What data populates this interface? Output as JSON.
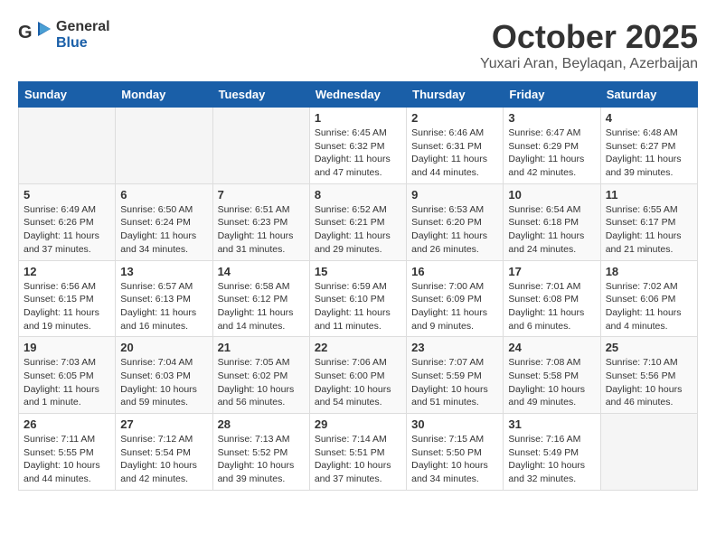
{
  "header": {
    "logo_general": "General",
    "logo_blue": "Blue",
    "month": "October 2025",
    "location": "Yuxari Aran, Beylaqan, Azerbaijan"
  },
  "weekdays": [
    "Sunday",
    "Monday",
    "Tuesday",
    "Wednesday",
    "Thursday",
    "Friday",
    "Saturday"
  ],
  "weeks": [
    [
      {
        "day": "",
        "info": ""
      },
      {
        "day": "",
        "info": ""
      },
      {
        "day": "",
        "info": ""
      },
      {
        "day": "1",
        "info": "Sunrise: 6:45 AM\nSunset: 6:32 PM\nDaylight: 11 hours and 47 minutes."
      },
      {
        "day": "2",
        "info": "Sunrise: 6:46 AM\nSunset: 6:31 PM\nDaylight: 11 hours and 44 minutes."
      },
      {
        "day": "3",
        "info": "Sunrise: 6:47 AM\nSunset: 6:29 PM\nDaylight: 11 hours and 42 minutes."
      },
      {
        "day": "4",
        "info": "Sunrise: 6:48 AM\nSunset: 6:27 PM\nDaylight: 11 hours and 39 minutes."
      }
    ],
    [
      {
        "day": "5",
        "info": "Sunrise: 6:49 AM\nSunset: 6:26 PM\nDaylight: 11 hours and 37 minutes."
      },
      {
        "day": "6",
        "info": "Sunrise: 6:50 AM\nSunset: 6:24 PM\nDaylight: 11 hours and 34 minutes."
      },
      {
        "day": "7",
        "info": "Sunrise: 6:51 AM\nSunset: 6:23 PM\nDaylight: 11 hours and 31 minutes."
      },
      {
        "day": "8",
        "info": "Sunrise: 6:52 AM\nSunset: 6:21 PM\nDaylight: 11 hours and 29 minutes."
      },
      {
        "day": "9",
        "info": "Sunrise: 6:53 AM\nSunset: 6:20 PM\nDaylight: 11 hours and 26 minutes."
      },
      {
        "day": "10",
        "info": "Sunrise: 6:54 AM\nSunset: 6:18 PM\nDaylight: 11 hours and 24 minutes."
      },
      {
        "day": "11",
        "info": "Sunrise: 6:55 AM\nSunset: 6:17 PM\nDaylight: 11 hours and 21 minutes."
      }
    ],
    [
      {
        "day": "12",
        "info": "Sunrise: 6:56 AM\nSunset: 6:15 PM\nDaylight: 11 hours and 19 minutes."
      },
      {
        "day": "13",
        "info": "Sunrise: 6:57 AM\nSunset: 6:13 PM\nDaylight: 11 hours and 16 minutes."
      },
      {
        "day": "14",
        "info": "Sunrise: 6:58 AM\nSunset: 6:12 PM\nDaylight: 11 hours and 14 minutes."
      },
      {
        "day": "15",
        "info": "Sunrise: 6:59 AM\nSunset: 6:10 PM\nDaylight: 11 hours and 11 minutes."
      },
      {
        "day": "16",
        "info": "Sunrise: 7:00 AM\nSunset: 6:09 PM\nDaylight: 11 hours and 9 minutes."
      },
      {
        "day": "17",
        "info": "Sunrise: 7:01 AM\nSunset: 6:08 PM\nDaylight: 11 hours and 6 minutes."
      },
      {
        "day": "18",
        "info": "Sunrise: 7:02 AM\nSunset: 6:06 PM\nDaylight: 11 hours and 4 minutes."
      }
    ],
    [
      {
        "day": "19",
        "info": "Sunrise: 7:03 AM\nSunset: 6:05 PM\nDaylight: 11 hours and 1 minute."
      },
      {
        "day": "20",
        "info": "Sunrise: 7:04 AM\nSunset: 6:03 PM\nDaylight: 10 hours and 59 minutes."
      },
      {
        "day": "21",
        "info": "Sunrise: 7:05 AM\nSunset: 6:02 PM\nDaylight: 10 hours and 56 minutes."
      },
      {
        "day": "22",
        "info": "Sunrise: 7:06 AM\nSunset: 6:00 PM\nDaylight: 10 hours and 54 minutes."
      },
      {
        "day": "23",
        "info": "Sunrise: 7:07 AM\nSunset: 5:59 PM\nDaylight: 10 hours and 51 minutes."
      },
      {
        "day": "24",
        "info": "Sunrise: 7:08 AM\nSunset: 5:58 PM\nDaylight: 10 hours and 49 minutes."
      },
      {
        "day": "25",
        "info": "Sunrise: 7:10 AM\nSunset: 5:56 PM\nDaylight: 10 hours and 46 minutes."
      }
    ],
    [
      {
        "day": "26",
        "info": "Sunrise: 7:11 AM\nSunset: 5:55 PM\nDaylight: 10 hours and 44 minutes."
      },
      {
        "day": "27",
        "info": "Sunrise: 7:12 AM\nSunset: 5:54 PM\nDaylight: 10 hours and 42 minutes."
      },
      {
        "day": "28",
        "info": "Sunrise: 7:13 AM\nSunset: 5:52 PM\nDaylight: 10 hours and 39 minutes."
      },
      {
        "day": "29",
        "info": "Sunrise: 7:14 AM\nSunset: 5:51 PM\nDaylight: 10 hours and 37 minutes."
      },
      {
        "day": "30",
        "info": "Sunrise: 7:15 AM\nSunset: 5:50 PM\nDaylight: 10 hours and 34 minutes."
      },
      {
        "day": "31",
        "info": "Sunrise: 7:16 AM\nSunset: 5:49 PM\nDaylight: 10 hours and 32 minutes."
      },
      {
        "day": "",
        "info": ""
      }
    ]
  ]
}
